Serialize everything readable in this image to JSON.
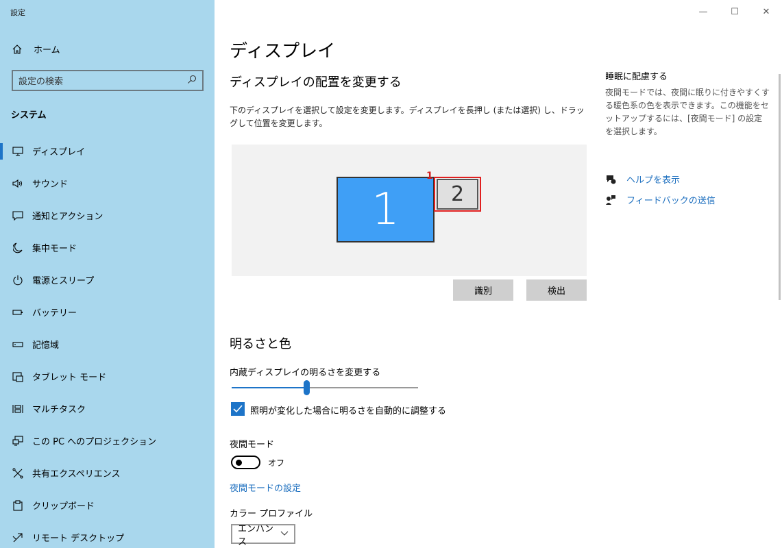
{
  "app_title": "設定",
  "window_controls": {
    "minimize": "—",
    "maximize": "☐",
    "close": "✕"
  },
  "sidebar": {
    "home_label": "ホーム",
    "search_placeholder": "設定の検索",
    "section_title": "システム",
    "items": [
      {
        "label": "ディスプレイ",
        "icon": "monitor-icon",
        "active": true
      },
      {
        "label": "サウンド",
        "icon": "speaker-icon"
      },
      {
        "label": "通知とアクション",
        "icon": "notification-icon"
      },
      {
        "label": "集中モード",
        "icon": "moon-icon"
      },
      {
        "label": "電源とスリープ",
        "icon": "power-icon"
      },
      {
        "label": "バッテリー",
        "icon": "battery-icon"
      },
      {
        "label": "記憶域",
        "icon": "storage-icon"
      },
      {
        "label": "タブレット モード",
        "icon": "tablet-icon"
      },
      {
        "label": "マルチタスク",
        "icon": "multitask-icon"
      },
      {
        "label": "この PC へのプロジェクション",
        "icon": "projection-icon"
      },
      {
        "label": "共有エクスペリエンス",
        "icon": "share-icon"
      },
      {
        "label": "クリップボード",
        "icon": "clipboard-icon"
      },
      {
        "label": "リモート デスクトップ",
        "icon": "remote-icon"
      }
    ]
  },
  "main": {
    "page_title": "ディスプレイ",
    "arrange_title": "ディスプレイの配置を変更する",
    "arrange_desc": "下のディスプレイを選択して設定を変更します。ディスプレイを長押し (または選択) し、ドラッグして位置を変更します。",
    "monitor1_label": "1",
    "monitor2_label": "2",
    "annotation_marker": "1",
    "identify_button": "識別",
    "detect_button": "検出",
    "brightness_title": "明るさと色",
    "brightness_label": "内蔵ディスプレイの明るさを変更する",
    "brightness_value": 40,
    "auto_brightness_label": "照明が変化した場合に明るさを自動的に調整する",
    "auto_brightness_checked": true,
    "night_mode_label": "夜間モード",
    "night_mode_state": "オフ",
    "night_mode_link": "夜間モードの設定",
    "color_profile_label": "カラー プロファイル",
    "color_profile_value": "エンハンス"
  },
  "right": {
    "title": "睡眠に配慮する",
    "desc": "夜間モードでは、夜間に眠りに付きやすくする暖色系の色を表示できます。この機能をセットアップするには、[夜間モード] の設定を選択します。",
    "help_link": "ヘルプを表示",
    "feedback_link": "フィードバックの送信"
  },
  "colors": {
    "sidebar_bg": "#a9d7ed",
    "accent": "#1d74c8",
    "monitor_selected": "#3f9ff6",
    "annotation": "#e02020"
  }
}
